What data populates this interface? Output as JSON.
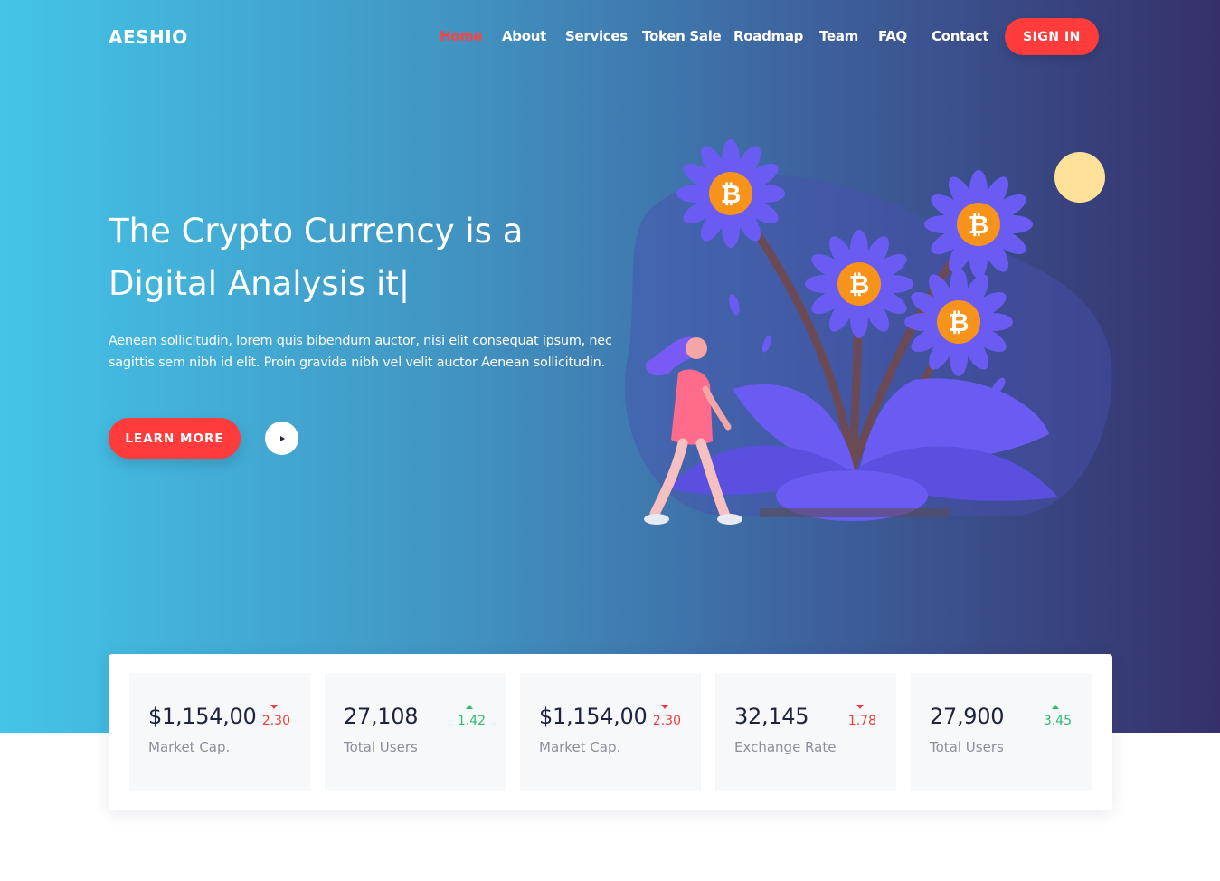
{
  "brand": {
    "logo": "AESHIO"
  },
  "nav": {
    "items": [
      {
        "label": "Home",
        "active": true
      },
      {
        "label": "About",
        "active": false
      },
      {
        "label": "Services",
        "active": false
      },
      {
        "label": "Token Sale",
        "active": false
      },
      {
        "label": "Roadmap",
        "active": false
      },
      {
        "label": "Team",
        "active": false
      },
      {
        "label": "FAQ",
        "active": false
      },
      {
        "label": "Contact",
        "active": false
      }
    ],
    "signin_label": "SIGN IN"
  },
  "hero": {
    "title": "The Crypto Currency is a Digital Analysis it|",
    "description": "Aenean sollicitudin, lorem quis bibendum auctor, nisi elit consequat ipsum, nec sagittis sem nibh id elit. Proin gravida nibh vel velit auctor Aenean sollicitudin.",
    "learn_more_label": "LEARN MORE",
    "coin_symbol": "₿"
  },
  "stats": [
    {
      "value": "$1,154,00",
      "label": "Market Cap.",
      "change": "2.30",
      "direction": "down"
    },
    {
      "value": "27,108",
      "label": "Total Users",
      "change": "1.42",
      "direction": "up"
    },
    {
      "value": "$1,154,00",
      "label": "Market Cap.",
      "change": "2.30",
      "direction": "down"
    },
    {
      "value": "32,145",
      "label": "Exchange Rate",
      "change": "1.78",
      "direction": "down"
    },
    {
      "value": "27,900",
      "label": "Total Users",
      "change": "3.45",
      "direction": "up"
    }
  ],
  "colors": {
    "accent": "#ff3b3b",
    "up": "#2ebc6e",
    "down": "#f03c3c",
    "flower": "#6a5cf2",
    "coin": "#f7931a",
    "sun": "#ffe19a"
  }
}
